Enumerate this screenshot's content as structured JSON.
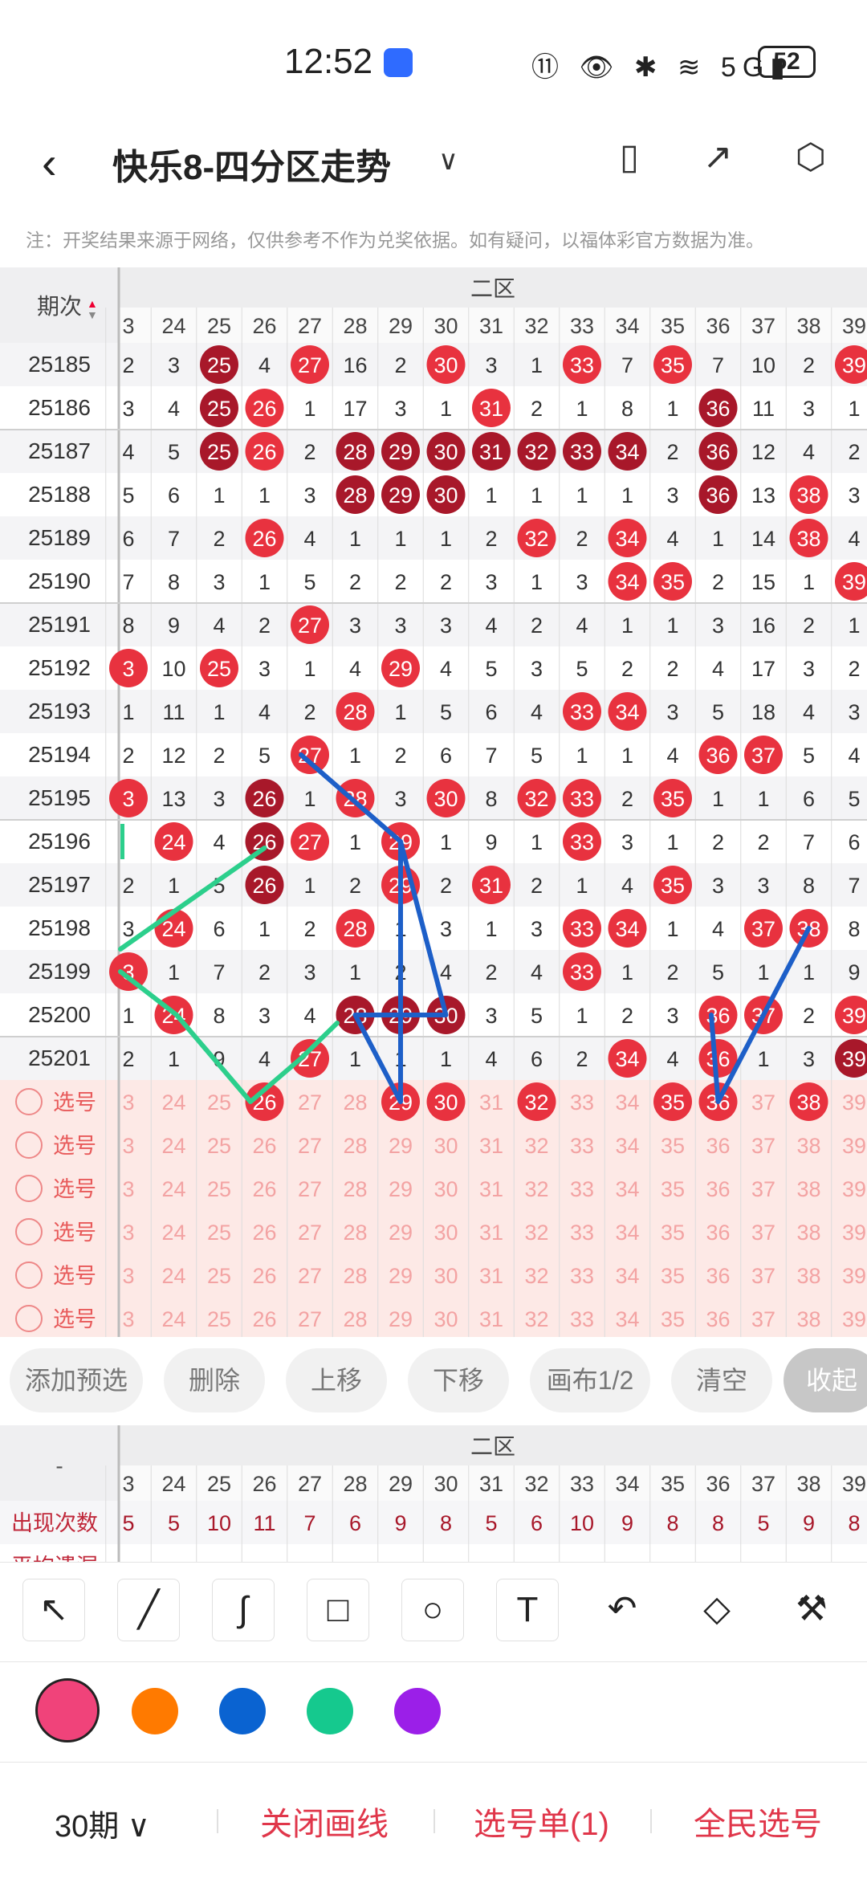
{
  "status_bar": {
    "time": "12:52",
    "icons_text": "⑪ 👁 ✱ ≋ 5G▮",
    "battery": "52"
  },
  "header": {
    "title": "快乐8-四分区走势",
    "back_icon": "back-arrow-icon",
    "dropdown_icon": "chevron-down-icon"
  },
  "notice": "注：开奖结果来源于网络，仅供参考不作为兑奖依据。如有疑问，以福体彩官方数据为准。",
  "table": {
    "issue_header": "期次",
    "zone_label": "二区",
    "columns": [
      "3",
      "24",
      "25",
      "26",
      "27",
      "28",
      "29",
      "30",
      "31",
      "32",
      "33",
      "34",
      "35",
      "36",
      "37",
      "38",
      "39"
    ],
    "rows": [
      {
        "issue": "25185",
        "cells": [
          2,
          3,
          25,
          4,
          27,
          16,
          2,
          30,
          3,
          1,
          33,
          7,
          35,
          7,
          10,
          2,
          39
        ],
        "hits": [
          25,
          27,
          30,
          33,
          35,
          39
        ],
        "dark": [
          25
        ]
      },
      {
        "issue": "25186",
        "cells": [
          3,
          4,
          25,
          26,
          1,
          17,
          3,
          1,
          31,
          2,
          1,
          8,
          1,
          36,
          11,
          3,
          1
        ],
        "hits": [
          25,
          26,
          31,
          36
        ],
        "dark": [
          25,
          36
        ]
      },
      {
        "issue": "25187",
        "cells": [
          4,
          5,
          25,
          26,
          2,
          28,
          29,
          30,
          31,
          32,
          33,
          34,
          2,
          36,
          12,
          4,
          2
        ],
        "hits": [
          25,
          26,
          28,
          29,
          30,
          31,
          32,
          33,
          34,
          36
        ],
        "dark": [
          25,
          28,
          29,
          30,
          31,
          32,
          33,
          34,
          36
        ]
      },
      {
        "issue": "25188",
        "cells": [
          5,
          6,
          1,
          1,
          3,
          28,
          29,
          30,
          1,
          1,
          1,
          1,
          3,
          36,
          13,
          38,
          3
        ],
        "hits": [
          28,
          29,
          30,
          36,
          38
        ],
        "dark": [
          28,
          29,
          30,
          36
        ]
      },
      {
        "issue": "25189",
        "cells": [
          6,
          7,
          2,
          26,
          4,
          1,
          1,
          1,
          2,
          32,
          2,
          34,
          4,
          1,
          14,
          38,
          4
        ],
        "hits": [
          26,
          32,
          34,
          38
        ],
        "dark": []
      },
      {
        "issue": "25190",
        "cells": [
          7,
          8,
          3,
          1,
          5,
          2,
          2,
          2,
          3,
          1,
          3,
          34,
          35,
          2,
          15,
          1,
          39
        ],
        "hits": [
          34,
          35,
          39
        ],
        "dark": []
      },
      {
        "issue": "25191",
        "cells": [
          8,
          9,
          4,
          2,
          27,
          3,
          3,
          3,
          4,
          2,
          4,
          1,
          1,
          3,
          16,
          2,
          1
        ],
        "hits": [
          27
        ],
        "dark": []
      },
      {
        "issue": "25192",
        "cells": [
          3,
          10,
          25,
          3,
          1,
          4,
          29,
          4,
          5,
          3,
          5,
          2,
          2,
          4,
          17,
          3,
          2
        ],
        "hits": [
          3,
          25,
          29
        ],
        "dark": []
      },
      {
        "issue": "25193",
        "cells": [
          1,
          11,
          1,
          4,
          2,
          28,
          1,
          5,
          6,
          4,
          33,
          34,
          3,
          5,
          18,
          4,
          3
        ],
        "hits": [
          28,
          33,
          34
        ],
        "dark": []
      },
      {
        "issue": "25194",
        "cells": [
          2,
          12,
          2,
          5,
          27,
          1,
          2,
          6,
          7,
          5,
          1,
          1,
          4,
          36,
          37,
          5,
          4
        ],
        "hits": [
          27,
          36,
          37
        ],
        "dark": []
      },
      {
        "issue": "25195",
        "cells": [
          3,
          13,
          3,
          26,
          1,
          28,
          3,
          30,
          8,
          32,
          33,
          2,
          35,
          1,
          1,
          6,
          5
        ],
        "hits": [
          3,
          26,
          28,
          30,
          32,
          33,
          35
        ],
        "dark": [
          26
        ]
      },
      {
        "issue": "25196",
        "cells": [
          "",
          24,
          4,
          26,
          27,
          1,
          29,
          1,
          9,
          1,
          33,
          3,
          1,
          2,
          2,
          7,
          6
        ],
        "hits": [
          24,
          26,
          27,
          29,
          33
        ],
        "dark": [
          26
        ]
      },
      {
        "issue": "25197",
        "cells": [
          2,
          1,
          5,
          26,
          1,
          2,
          29,
          2,
          31,
          2,
          1,
          4,
          35,
          3,
          3,
          8,
          7
        ],
        "hits": [
          26,
          29,
          31,
          35
        ],
        "dark": [
          26
        ]
      },
      {
        "issue": "25198",
        "cells": [
          3,
          24,
          6,
          1,
          2,
          28,
          1,
          3,
          1,
          3,
          33,
          34,
          1,
          4,
          37,
          38,
          8
        ],
        "hits": [
          24,
          28,
          33,
          34,
          37,
          38
        ],
        "dark": []
      },
      {
        "issue": "25199",
        "cells": [
          3,
          1,
          7,
          2,
          3,
          1,
          2,
          4,
          2,
          4,
          33,
          1,
          2,
          5,
          1,
          1,
          9
        ],
        "hits": [
          3,
          33
        ],
        "dark": []
      },
      {
        "issue": "25200",
        "cells": [
          1,
          24,
          8,
          3,
          4,
          28,
          29,
          30,
          3,
          5,
          1,
          2,
          3,
          36,
          37,
          2,
          39
        ],
        "hits": [
          24,
          28,
          29,
          30,
          36,
          37,
          39
        ],
        "dark": [
          28,
          29,
          30
        ]
      },
      {
        "issue": "25201",
        "cells": [
          2,
          1,
          9,
          4,
          27,
          1,
          1,
          1,
          4,
          6,
          2,
          34,
          4,
          36,
          1,
          3,
          39
        ],
        "hits": [
          27,
          34,
          36,
          39
        ],
        "dark": [
          39
        ]
      }
    ],
    "pick_rows": [
      {
        "label": "选号",
        "selected": [
          26,
          29,
          30,
          32,
          35,
          36,
          38
        ]
      },
      {
        "label": "选号",
        "selected": []
      },
      {
        "label": "选号",
        "selected": []
      },
      {
        "label": "选号",
        "selected": []
      },
      {
        "label": "选号",
        "selected": []
      },
      {
        "label": "选号",
        "selected": []
      }
    ]
  },
  "actions": [
    "添加预选",
    "删除",
    "上移",
    "下移",
    "画布1/2",
    "清空",
    "收起"
  ],
  "stats": {
    "header_left": "-",
    "zone_label": "二区",
    "columns": [
      "3",
      "24",
      "25",
      "26",
      "27",
      "28",
      "29",
      "30",
      "31",
      "32",
      "33",
      "34",
      "35",
      "36",
      "37",
      "38",
      "39"
    ],
    "rows": [
      {
        "label": "出现次数",
        "values": [
          "5",
          "5",
          "10",
          "11",
          "7",
          "6",
          "9",
          "8",
          "5",
          "6",
          "10",
          "9",
          "8",
          "8",
          "5",
          "9",
          "8"
        ]
      },
      {
        "label": "平均遗漏",
        "values": [
          "",
          "",
          "",
          "",
          "",
          "",
          "",
          "",
          "",
          "",
          "",
          "",
          "",
          "",
          "",
          "",
          ""
        ]
      }
    ]
  },
  "draw_tools": [
    "arrow-icon",
    "line-icon",
    "curve-icon",
    "rectangle-icon",
    "circle-icon",
    "text-icon",
    "undo-icon",
    "eraser-icon",
    "clear-brush-icon"
  ],
  "text_tool_glyph": "T",
  "pen_colors": [
    "#f0437a",
    "#ff7a00",
    "#0a63d1",
    "#15c98e",
    "#9b1fe8"
  ],
  "bottom_bar": {
    "period": "30期",
    "close_lines": "关闭画线",
    "pick_list": "选号单(1)",
    "national_pick": "全民选号"
  },
  "colors": {
    "red": "#e8323f",
    "dark_red": "#a8182a",
    "blue_line": "#1d5fc8",
    "green_line": "#2ccf8c",
    "pick_bg": "#fde9e6"
  }
}
